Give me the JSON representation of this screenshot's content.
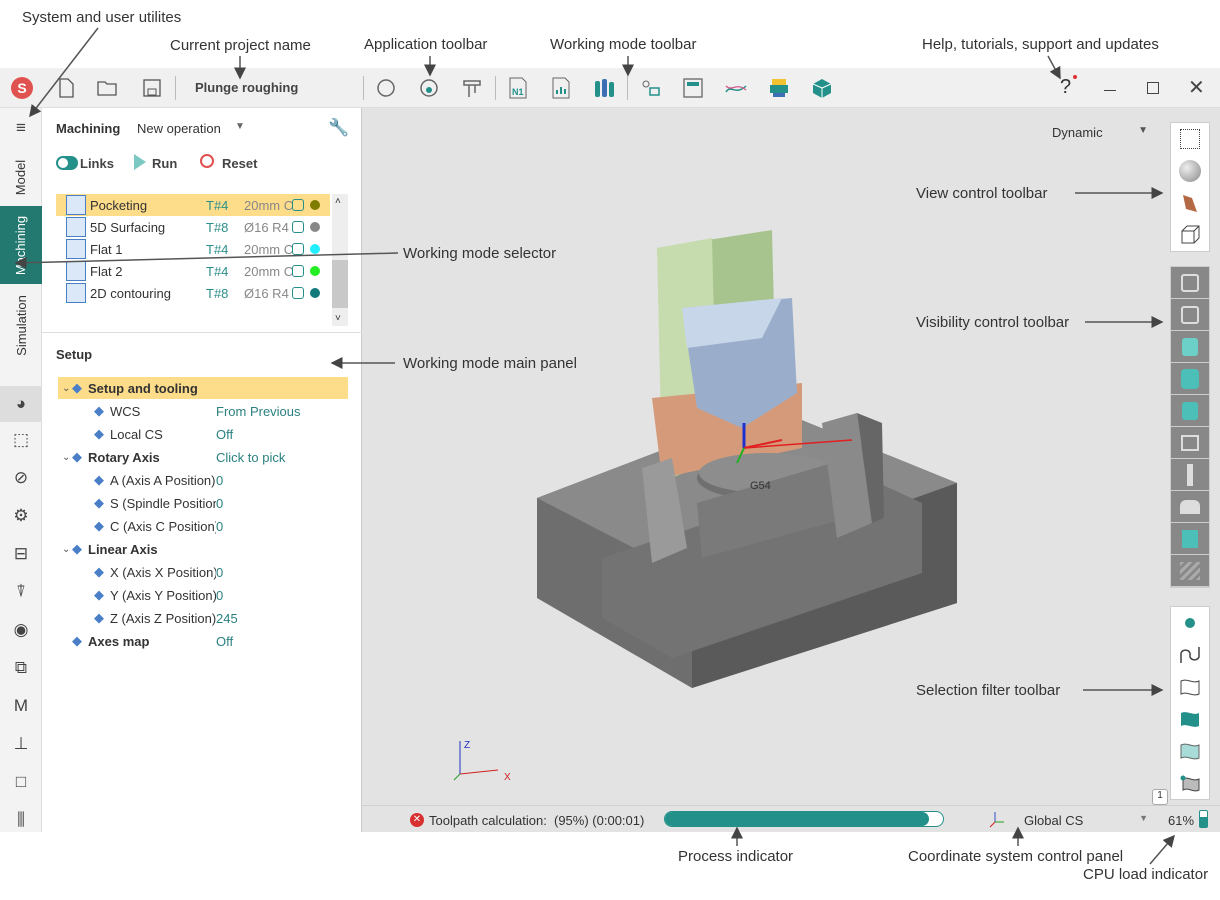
{
  "annotations": {
    "system_utils": "System and user utilites",
    "project_name": "Current project name",
    "app_toolbar": "Application toolbar",
    "mode_toolbar": "Working mode toolbar",
    "help": "Help, tutorials, support and updates",
    "view_control": "View control toolbar",
    "mode_selector": "Working mode selector",
    "visibility": "Visibility control toolbar",
    "main_panel": "Working mode main panel",
    "selection_filter": "Selection filter toolbar",
    "process": "Process indicator",
    "cs_panel": "Coordinate system control panel",
    "cpu": "CPU load indicator"
  },
  "titlebar": {
    "project": "Plunge roughing",
    "help": "?"
  },
  "rail": {
    "tabs": [
      "Model",
      "Machining",
      "Simulation"
    ],
    "active": "Machining"
  },
  "panel": {
    "header": "Machining",
    "new_op": "New operation",
    "links": "Links",
    "run": "Run",
    "reset": "Reset",
    "operations": [
      {
        "name": "Pocketing",
        "tool": "T#4",
        "desc": "20mm C",
        "color": "#7f7a00",
        "selected": true
      },
      {
        "name": "5D Surfacing",
        "tool": "T#8",
        "desc": "Ø16 R4",
        "color": "#888888"
      },
      {
        "name": "Flat 1",
        "tool": "T#4",
        "desc": "20mm C",
        "color": "#22eeff"
      },
      {
        "name": "Flat 2",
        "tool": "T#4",
        "desc": "20mm C",
        "color": "#22ee22"
      },
      {
        "name": "2D contouring",
        "tool": "T#8",
        "desc": "Ø16 R4",
        "color": "#107a7a"
      }
    ],
    "setup_title": "Setup",
    "tree": [
      {
        "label": "Setup and tooling",
        "value": "",
        "bold": true,
        "sel": true,
        "indent": 0,
        "exp": true
      },
      {
        "label": "WCS",
        "value": "From Previous",
        "indent": 1
      },
      {
        "label": "Local CS",
        "value": "Off",
        "indent": 1
      },
      {
        "label": "Rotary Axis",
        "value": "Click to pick",
        "bold": true,
        "indent": 0,
        "exp": true
      },
      {
        "label": "A (Axis A Position)",
        "value": "0",
        "indent": 1
      },
      {
        "label": "S (Spindle Position)",
        "value": "0",
        "indent": 1
      },
      {
        "label": "C (Axis C Position)",
        "value": "0",
        "indent": 1
      },
      {
        "label": "Linear Axis",
        "value": "",
        "bold": true,
        "indent": 0,
        "exp": true
      },
      {
        "label": "X (Axis X Position)",
        "value": "0",
        "indent": 1
      },
      {
        "label": "Y (Axis Y Position)",
        "value": "0",
        "indent": 1
      },
      {
        "label": "Z (Axis Z Position)",
        "value": "245",
        "indent": 1
      },
      {
        "label": "Axes map",
        "value": "Off",
        "bold": true,
        "indent": 0
      }
    ]
  },
  "viewport": {
    "view_mode": "Dynamic",
    "wcs_label": "G54",
    "axis_x": "X",
    "axis_z": "Z",
    "badge": "1"
  },
  "status": {
    "calc_label": "Toolpath calculation:",
    "calc_value": "(95%) (0:00:01)",
    "progress_percent": 95,
    "cs": "Global CS",
    "cpu": "61%"
  },
  "colors": {
    "accent": "#23918a",
    "selection": "#fddc8a"
  }
}
